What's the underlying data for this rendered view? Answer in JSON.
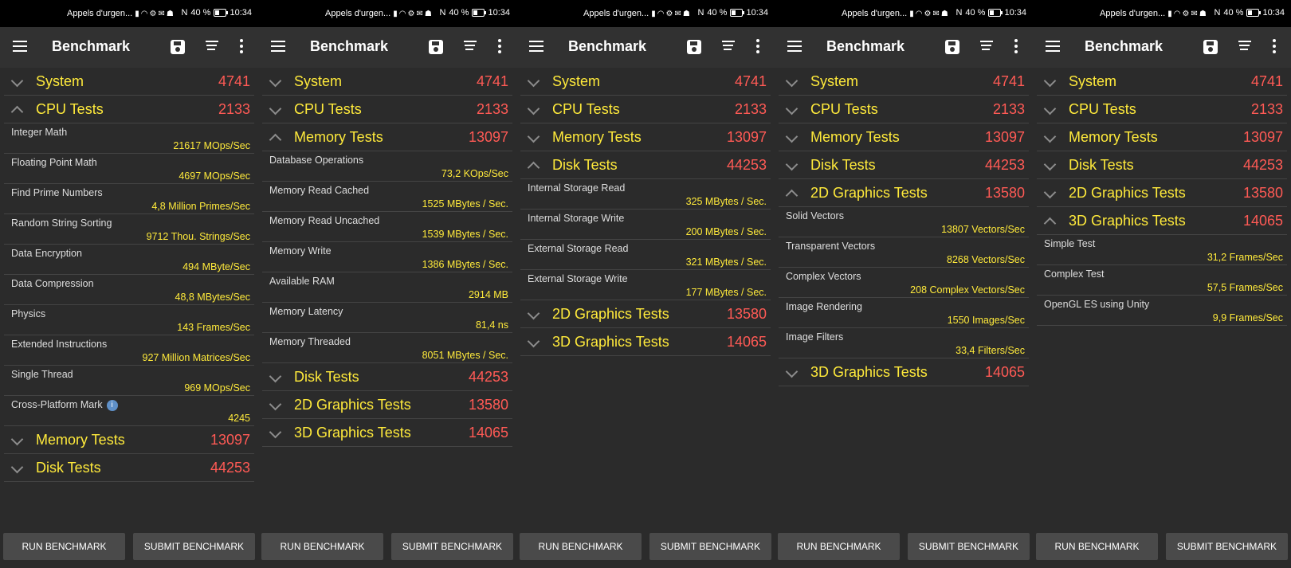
{
  "status": {
    "left": "Appels d'urgen...",
    "battery": "40 %",
    "time": "10:34",
    "icons": [
      "sim-icon",
      "wifi-icon",
      "settings-icon",
      "mail-icon",
      "android-icon"
    ],
    "nfc": "N"
  },
  "app": {
    "title": "Benchmark",
    "icons": [
      "menu-icon",
      "save-icon",
      "sort-icon",
      "more-vertical-icon"
    ]
  },
  "footer": {
    "run": "RUN BENCHMARK",
    "submit": "SUBMIT BENCHMARK"
  },
  "screens": [
    {
      "categories": [
        {
          "name": "System",
          "score": "4741",
          "open": false,
          "tests": []
        },
        {
          "name": "CPU Tests",
          "score": "2133",
          "open": true,
          "tests": [
            {
              "name": "Integer Math",
              "value": "21617 MOps/Sec"
            },
            {
              "name": "Floating Point Math",
              "value": "4697 MOps/Sec"
            },
            {
              "name": "Find Prime Numbers",
              "value": "4,8 Million Primes/Sec"
            },
            {
              "name": "Random String Sorting",
              "value": "9712 Thou. Strings/Sec"
            },
            {
              "name": "Data Encryption",
              "value": "494 MByte/Sec"
            },
            {
              "name": "Data Compression",
              "value": "48,8 MBytes/Sec"
            },
            {
              "name": "Physics",
              "value": "143 Frames/Sec"
            },
            {
              "name": "Extended Instructions",
              "value": "927 Million Matrices/Sec"
            },
            {
              "name": "Single Thread",
              "value": "969 MOps/Sec"
            },
            {
              "name": "Cross-Platform Mark",
              "value": "4245",
              "info": true
            }
          ]
        },
        {
          "name": "Memory Tests",
          "score": "13097",
          "open": false,
          "tests": []
        },
        {
          "name": "Disk Tests",
          "score": "44253",
          "open": false,
          "tests": []
        }
      ]
    },
    {
      "categories": [
        {
          "name": "System",
          "score": "4741",
          "open": false,
          "tests": []
        },
        {
          "name": "CPU Tests",
          "score": "2133",
          "open": false,
          "tests": []
        },
        {
          "name": "Memory Tests",
          "score": "13097",
          "open": true,
          "tests": [
            {
              "name": "Database Operations",
              "value": "73,2 KOps/Sec"
            },
            {
              "name": "Memory Read Cached",
              "value": "1525 MBytes / Sec."
            },
            {
              "name": "Memory Read Uncached",
              "value": "1539 MBytes / Sec."
            },
            {
              "name": "Memory Write",
              "value": "1386 MBytes / Sec."
            },
            {
              "name": "Available RAM",
              "value": "2914 MB"
            },
            {
              "name": "Memory Latency",
              "value": "81,4 ns"
            },
            {
              "name": "Memory Threaded",
              "value": "8051 MBytes / Sec."
            }
          ]
        },
        {
          "name": "Disk Tests",
          "score": "44253",
          "open": false,
          "tests": []
        },
        {
          "name": "2D Graphics Tests",
          "score": "13580",
          "open": false,
          "tests": []
        },
        {
          "name": "3D Graphics Tests",
          "score": "14065",
          "open": false,
          "tests": []
        }
      ]
    },
    {
      "categories": [
        {
          "name": "System",
          "score": "4741",
          "open": false,
          "tests": []
        },
        {
          "name": "CPU Tests",
          "score": "2133",
          "open": false,
          "tests": []
        },
        {
          "name": "Memory Tests",
          "score": "13097",
          "open": false,
          "tests": []
        },
        {
          "name": "Disk Tests",
          "score": "44253",
          "open": true,
          "tests": [
            {
              "name": "Internal Storage Read",
              "value": "325 MBytes / Sec."
            },
            {
              "name": "Internal Storage Write",
              "value": "200 MBytes / Sec."
            },
            {
              "name": "External Storage Read",
              "value": "321 MBytes / Sec."
            },
            {
              "name": "External Storage Write",
              "value": "177 MBytes / Sec."
            }
          ]
        },
        {
          "name": "2D Graphics Tests",
          "score": "13580",
          "open": false,
          "tests": []
        },
        {
          "name": "3D Graphics Tests",
          "score": "14065",
          "open": false,
          "tests": []
        }
      ]
    },
    {
      "categories": [
        {
          "name": "System",
          "score": "4741",
          "open": false,
          "tests": []
        },
        {
          "name": "CPU Tests",
          "score": "2133",
          "open": false,
          "tests": []
        },
        {
          "name": "Memory Tests",
          "score": "13097",
          "open": false,
          "tests": []
        },
        {
          "name": "Disk Tests",
          "score": "44253",
          "open": false,
          "tests": []
        },
        {
          "name": "2D Graphics Tests",
          "score": "13580",
          "open": true,
          "tests": [
            {
              "name": "Solid Vectors",
              "value": "13807 Vectors/Sec"
            },
            {
              "name": "Transparent Vectors",
              "value": "8268 Vectors/Sec"
            },
            {
              "name": "Complex Vectors",
              "value": "208 Complex Vectors/Sec"
            },
            {
              "name": "Image Rendering",
              "value": "1550 Images/Sec"
            },
            {
              "name": "Image Filters",
              "value": "33,4 Filters/Sec"
            }
          ]
        },
        {
          "name": "3D Graphics Tests",
          "score": "14065",
          "open": false,
          "tests": []
        }
      ]
    },
    {
      "categories": [
        {
          "name": "System",
          "score": "4741",
          "open": false,
          "tests": []
        },
        {
          "name": "CPU Tests",
          "score": "2133",
          "open": false,
          "tests": []
        },
        {
          "name": "Memory Tests",
          "score": "13097",
          "open": false,
          "tests": []
        },
        {
          "name": "Disk Tests",
          "score": "44253",
          "open": false,
          "tests": []
        },
        {
          "name": "2D Graphics Tests",
          "score": "13580",
          "open": false,
          "tests": []
        },
        {
          "name": "3D Graphics Tests",
          "score": "14065",
          "open": true,
          "tests": [
            {
              "name": "Simple Test",
              "value": "31,2 Frames/Sec"
            },
            {
              "name": "Complex Test",
              "value": "57,5 Frames/Sec"
            },
            {
              "name": "OpenGL ES using Unity",
              "value": "9,9 Frames/Sec"
            }
          ]
        }
      ]
    }
  ]
}
